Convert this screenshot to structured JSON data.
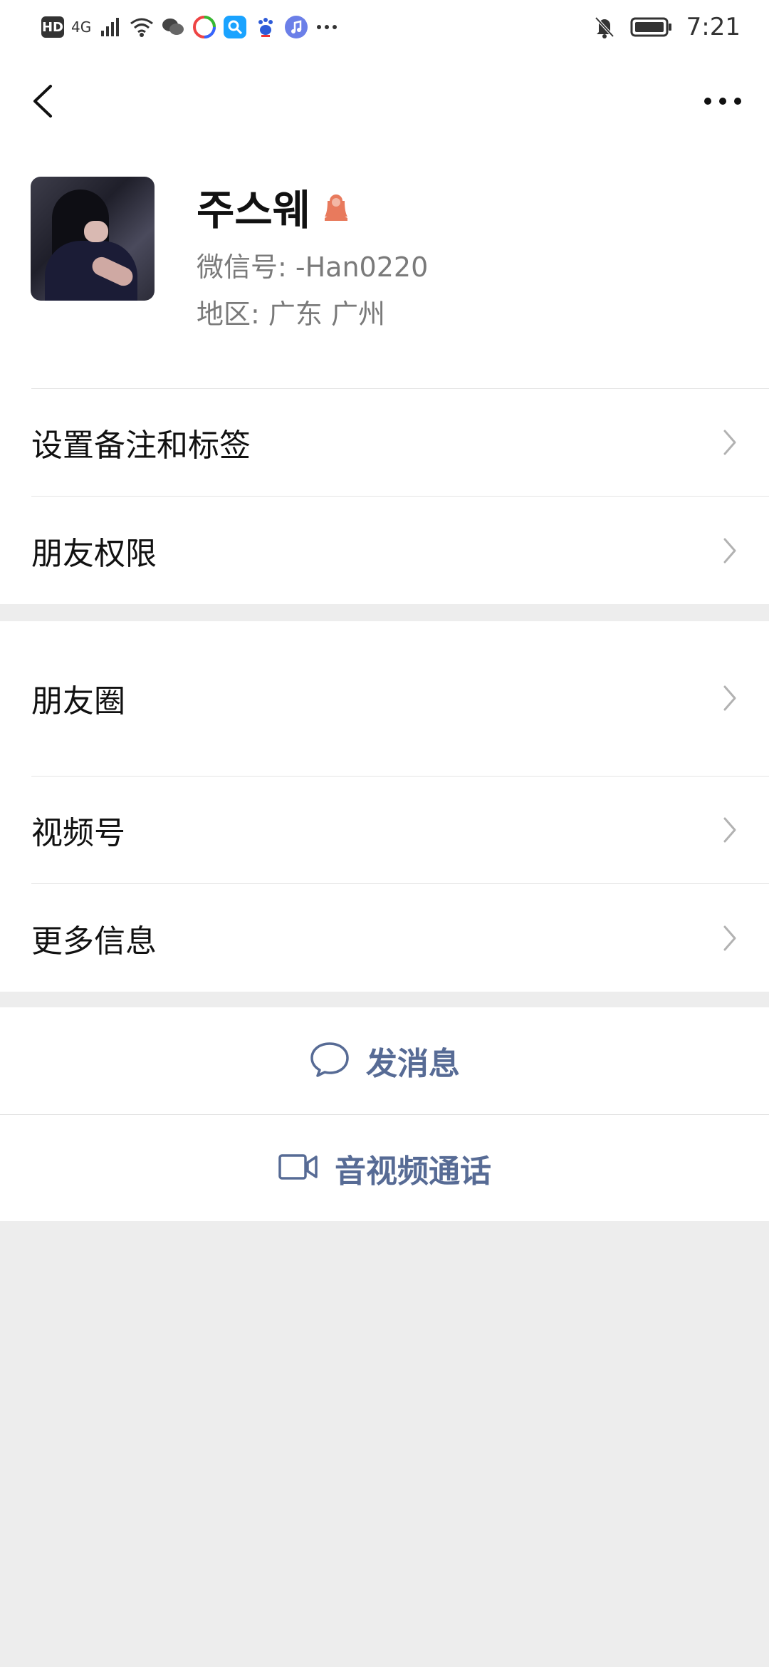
{
  "status_bar": {
    "hd": "HD",
    "network": "4G",
    "time": "7:21",
    "icons": [
      "signal-icon",
      "wifi-icon",
      "wechat-icon",
      "app-icon",
      "search-app-icon",
      "baidu-icon",
      "music-icon",
      "more-dots-icon",
      "mute-bell-icon",
      "battery-icon"
    ]
  },
  "nav": {
    "back_icon": "chevron-left-icon",
    "more_icon": "more-dots-icon"
  },
  "profile": {
    "name": "주스웨",
    "gender_icon": "female-icon",
    "wechat_id": "微信号: -Han0220",
    "region": "地区: 广东  广州"
  },
  "group1": [
    {
      "label": "设置备注和标签"
    },
    {
      "label": "朋友权限"
    }
  ],
  "group2": [
    {
      "label": "朋友圈"
    },
    {
      "label": "视频号"
    },
    {
      "label": "更多信息"
    }
  ],
  "actions": {
    "message": "发消息",
    "call": "音视频通话"
  },
  "colors": {
    "link": "#576b95",
    "background": "#ededed",
    "gender": "#e87a5d"
  }
}
